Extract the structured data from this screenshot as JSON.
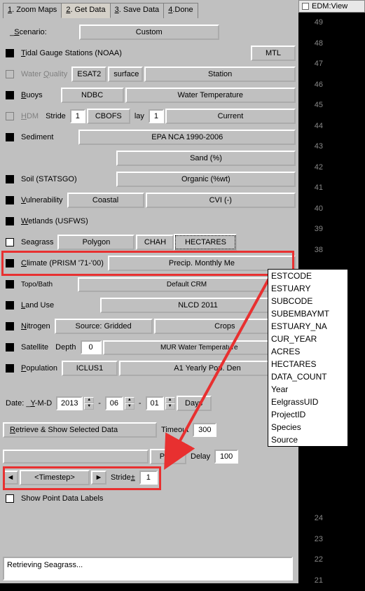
{
  "tabs": [
    {
      "label": "1. Zoom Maps",
      "u": "1"
    },
    {
      "label": "2. Get Data",
      "u": "2"
    },
    {
      "label": "3. Save Data",
      "u": "3"
    },
    {
      "label": "4.Done",
      "u": "4"
    }
  ],
  "scenario": {
    "label": "_Scenario:",
    "btn": "Custom",
    "u": "S"
  },
  "tidal": {
    "label": "Tidal Gauge Stations (NOAA)",
    "btn": "MTL",
    "u": "T"
  },
  "water": {
    "label": "Water Quality",
    "b1": "ESAT2",
    "b2": "surface",
    "b3": "Station",
    "u": "Q"
  },
  "buoys": {
    "label": "Buoys",
    "b1": "NDBC",
    "b2": "Water Temperature",
    "u": "B"
  },
  "hdm": {
    "label": "HDM",
    "stride": "Stride",
    "sv": "1",
    "b1": "CBOFS",
    "lay": "lay",
    "lv": "1",
    "b2": "Current",
    "u": "H"
  },
  "sediment": {
    "label": "Sediment",
    "b1": "EPA NCA 1990-2006",
    "b2": "Sand (%)"
  },
  "soil": {
    "label": "Soil (STATSGO)",
    "b1": "Organic (%wt)"
  },
  "vuln": {
    "label": "Vulnerability",
    "b1": "Coastal",
    "b2": "CVI (-)",
    "u": "V"
  },
  "wetlands": {
    "label": "Wetlands (USFWS)",
    "u": "W"
  },
  "seagrass": {
    "label": "Seagrass",
    "b1": "Polygon",
    "b2": "CHAH",
    "b3": "HECTARES"
  },
  "climate": {
    "label": "Climate (PRISM '71-'00)",
    "b1": "Precip. Monthly Me",
    "u": "C"
  },
  "topo": {
    "label": "Topo/Bath",
    "b1": "Default CRM"
  },
  "landuse": {
    "label": "Land Use",
    "b1": "NLCD 2011",
    "u": "L"
  },
  "nitrogen": {
    "label": "Nitrogen",
    "b1": "Source: Gridded",
    "b2": "Crops",
    "u": "N"
  },
  "satellite": {
    "label": "Satellite",
    "depth": "Depth",
    "dv": "0",
    "b1": "MUR Water Temperature"
  },
  "population": {
    "label": "Population",
    "b1": "ICLUS1",
    "b2": "A1 Yearly Pop. Den",
    "u": "P"
  },
  "date": {
    "label": "Date: _Y-M-D",
    "y": "2013",
    "m": "06",
    "d": "01",
    "days": "Days",
    "u": "Y"
  },
  "retrieve": {
    "label": "Retrieve & Show Selected Data",
    "timeout": "Timeout",
    "tv": "300",
    "u": "R"
  },
  "play": {
    "label": "Play!",
    "delay": "Delay",
    "dv": "100",
    "u": "!"
  },
  "timestep": {
    "label": "<Timestep>",
    "stride": "Stride±",
    "sv": "1",
    "u": "±"
  },
  "showpoint": {
    "label": "Show Point Data Labels"
  },
  "status": {
    "text": "Retrieving Seagrass..."
  },
  "sidebar": {
    "title": "EDM:View"
  },
  "ticks": [
    "49",
    "48",
    "47",
    "46",
    "45",
    "44",
    "43",
    "42",
    "41",
    "40",
    "39",
    "38",
    "",
    "",
    "",
    "",
    "",
    "",
    "",
    "",
    "",
    "",
    "",
    "",
    "24",
    "23",
    "22",
    "21"
  ],
  "dropdown": [
    "ESTCODE",
    "ESTUARY",
    "SUBCODE",
    "SUBEMBAYMT",
    "ESTUARY_NA",
    "CUR_YEAR",
    "ACRES",
    "HECTARES",
    "DATA_COUNT",
    "Year",
    "EelgrassUID",
    "ProjectID",
    "Species",
    "Source"
  ]
}
